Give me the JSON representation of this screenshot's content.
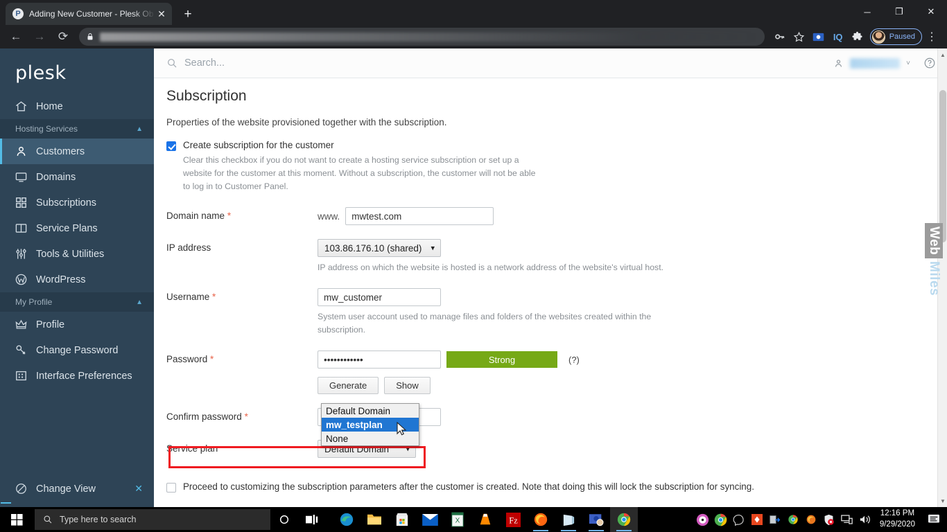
{
  "browser": {
    "tab": {
      "title": "Adding New Customer - Plesk Ob",
      "favicon_letter": "P",
      "close_icon": "✕"
    },
    "new_tab_icon": "+",
    "window_controls": {
      "minimize": "─",
      "maximize": "❐",
      "close": "✕"
    },
    "nav": {
      "back_icon": "←",
      "forward_icon": "→",
      "reload_icon": "⟳"
    },
    "omnibox": {
      "lock_icon": "lock-icon",
      "url": ""
    },
    "toolbar_icons": [
      "password-key-icon",
      "bookmark-star-icon",
      "screenshot-icon",
      "iq-extension-icon",
      "puzzle-extension-icon"
    ],
    "iq_label": "IQ",
    "profile": {
      "status_label": "Paused"
    },
    "menu_icon": "⋮"
  },
  "plesk": {
    "logo": "plesk",
    "sidebar": {
      "home": {
        "label": "Home",
        "icon": "home-icon"
      },
      "sections": [
        {
          "title": "Hosting Services",
          "collapse_icon": "chevron-up-icon",
          "items": [
            {
              "label": "Customers",
              "icon": "user-icon",
              "active": true
            },
            {
              "label": "Domains",
              "icon": "monitor-icon",
              "active": false
            },
            {
              "label": "Subscriptions",
              "icon": "grid-icon",
              "active": false
            },
            {
              "label": "Service Plans",
              "icon": "book-icon",
              "active": false
            },
            {
              "label": "Tools & Utilities",
              "icon": "sliders-icon",
              "active": false
            },
            {
              "label": "WordPress",
              "icon": "wordpress-icon",
              "active": false
            }
          ]
        },
        {
          "title": "My Profile",
          "collapse_icon": "chevron-up-icon",
          "items": [
            {
              "label": "Profile",
              "icon": "crown-icon",
              "active": false
            },
            {
              "label": "Change Password",
              "icon": "key-icon",
              "active": false
            },
            {
              "label": "Interface Preferences",
              "icon": "layout-icon",
              "active": false
            }
          ]
        }
      ],
      "change_view": {
        "label": "Change View",
        "icon": "slash-circle-icon",
        "close_icon": "✕"
      },
      "collapse_handle_icon": "chevron-left-icon"
    },
    "topbar": {
      "search_placeholder": "Search...",
      "search_icon": "search-icon",
      "user_icon": "user-icon",
      "user_chevron": "˅",
      "help_icon": "help-circle-icon"
    },
    "form": {
      "title": "Subscription",
      "intro": "Properties of the website provisioned together with the subscription.",
      "create_subscription": {
        "label": "Create subscription for the customer",
        "checked": true,
        "hint": "Clear this checkbox if you do not want to create a hosting service subscription or set up a website for the customer at this moment. Without a subscription, the customer will not be able to log in to Customer Panel."
      },
      "domain_name": {
        "label": "Domain name",
        "required": "*",
        "prefix": "www.",
        "value": "mwtest.com"
      },
      "ip_address": {
        "label": "IP address",
        "value": "103.86.176.10 (shared)",
        "options": [
          "103.86.176.10 (shared)"
        ],
        "hint": "IP address on which the website is hosted is a network address of the website's virtual host."
      },
      "username": {
        "label": "Username",
        "required": "*",
        "value": "mw_customer",
        "hint": "System user account used to manage files and folders of the websites created within the subscription."
      },
      "password": {
        "label": "Password",
        "required": "*",
        "value": "••••••••••••",
        "strength_label": "Strong",
        "strength_color": "#76a916",
        "help_marker": "(?)",
        "generate_label": "Generate",
        "show_label": "Show"
      },
      "confirm_password": {
        "label": "Confirm password",
        "required": "*",
        "value": ""
      },
      "service_plan": {
        "label": "Service plan",
        "value": "Default Domain",
        "options": [
          "Default Domain",
          "mw_testplan",
          "None"
        ],
        "highlighted_option": "mw_testplan",
        "highlight_color": "#ef1b21"
      },
      "proceed_checkbox": {
        "label": "Proceed to customizing the subscription parameters after the customer is created. Note that doing this will lock the subscription for syncing.",
        "checked": false
      }
    },
    "watermark": {
      "top": "Web",
      "bottom": "Miles"
    }
  },
  "taskbar": {
    "start_icon": "windows-start-icon",
    "search_placeholder": "Type here to search",
    "search_icon": "search-icon",
    "cortana_icon": "cortana-circle-icon",
    "taskview_icon": "task-view-icon",
    "apps": [
      "edge-icon",
      "file-explorer-icon",
      "microsoft-store-icon",
      "mail-icon",
      "excel-icon",
      "vlc-icon",
      "filezilla-icon",
      "firefox-icon",
      "onenote-icon",
      "teams-icon",
      "chrome-icon"
    ],
    "tray": [
      "itunes-icon",
      "chrome-tray-icon",
      "messenger-icon",
      "ant-icon",
      "backup-icon",
      "chrome-small-icon",
      "firefox-small-icon",
      "defender-icon",
      "network-icon",
      "volume-icon"
    ],
    "clock": {
      "time": "12:16 PM",
      "date": "9/29/2020"
    },
    "notification_icon": "action-center-icon"
  }
}
